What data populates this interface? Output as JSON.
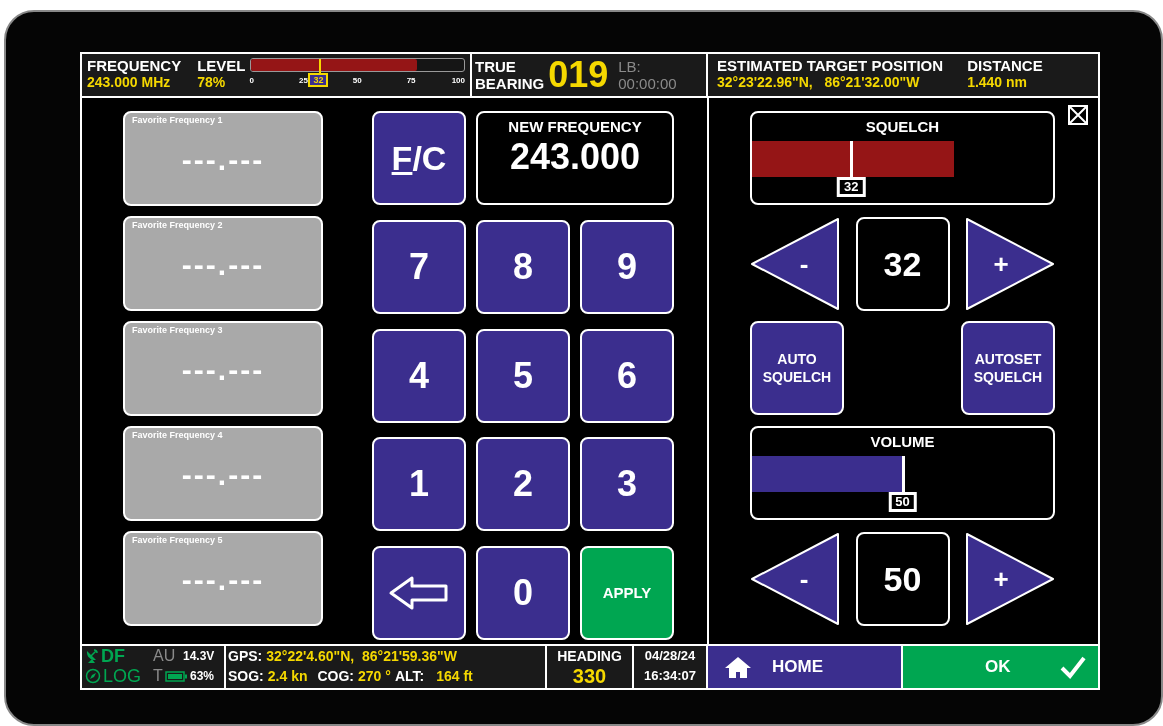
{
  "top_bar": {
    "frequency": {
      "label": "FREQUENCY",
      "value": "243.000 MHz"
    },
    "level": {
      "label": "LEVEL",
      "value": "78%",
      "level": 0.78,
      "ticks": [
        "0",
        "25",
        "50",
        "75",
        "100"
      ],
      "marker": {
        "level": 0.32,
        "reading": "32"
      }
    },
    "bearing": {
      "label_lines": [
        "TRUE",
        "BEARING"
      ],
      "value": "019",
      "lb_label": "LB:",
      "lb_time": "00:00:00"
    },
    "target": {
      "label": "ESTIMATED TARGET POSITION",
      "value": "32°23'22.96\"N,   86°21'32.00\"W"
    },
    "distance": {
      "label": "DISTANCE",
      "value": "1.440 nm"
    }
  },
  "favorites": [
    {
      "label": "Favorite Frequency 1",
      "value": "---.---"
    },
    {
      "label": "Favorite Frequency 2",
      "value": "---.---"
    },
    {
      "label": "Favorite Frequency 3",
      "value": "---.---"
    },
    {
      "label": "Favorite Frequency 4",
      "value": "---.---"
    },
    {
      "label": "Favorite Frequency 5",
      "value": "---.---"
    }
  ],
  "keypad": {
    "mode_key": {
      "hotkey": "F",
      "rest": "/C"
    },
    "display": {
      "label": "NEW FREQUENCY",
      "value": "243.000"
    },
    "keys": [
      {
        "kind": "digit",
        "label": "7"
      },
      {
        "kind": "digit",
        "label": "8"
      },
      {
        "kind": "digit",
        "label": "9"
      },
      {
        "kind": "digit",
        "label": "4"
      },
      {
        "kind": "digit",
        "label": "5"
      },
      {
        "kind": "digit",
        "label": "6"
      },
      {
        "kind": "digit",
        "label": "1"
      },
      {
        "kind": "digit",
        "label": "2"
      },
      {
        "kind": "digit",
        "label": "3"
      },
      {
        "kind": "backspace"
      },
      {
        "kind": "digit",
        "label": "0"
      },
      {
        "kind": "apply",
        "label": "APPLY"
      }
    ]
  },
  "squelch": {
    "label": "SQUELCH",
    "level": 0.67,
    "marker": {
      "level": 0.33,
      "reading": "32"
    },
    "value": "32",
    "decrease": "-",
    "increase": "+"
  },
  "auto_buttons": [
    {
      "lines": [
        "AUTO",
        "SQUELCH"
      ]
    },
    {
      "lines": [
        "AUTOSET",
        "SQUELCH"
      ]
    }
  ],
  "volume": {
    "label": "VOLUME",
    "level": 0.5,
    "marker": {
      "level": 0.5,
      "reading": "50"
    },
    "value": "50",
    "decrease": "-",
    "increase": "+"
  },
  "status_bar": {
    "df": "DF",
    "au": "AU",
    "voltage": "14.3V",
    "log": "LOG",
    "t": "T",
    "battery": "63%",
    "gps_label": "GPS:",
    "gps_value": "32°22'4.60\"N,  86°21'59.36\"W",
    "sog_label": "SOG:",
    "sog_value": "2.4 kn",
    "cog_label": "COG:",
    "cog_value": "270 °",
    "alt_label": "ALT:",
    "alt_value": "164 ft",
    "heading_label": "HEADING",
    "heading_value": "330",
    "date": "04/28/24",
    "time": "16:34:07"
  },
  "nav": {
    "home": "HOME",
    "ok": "OK"
  }
}
